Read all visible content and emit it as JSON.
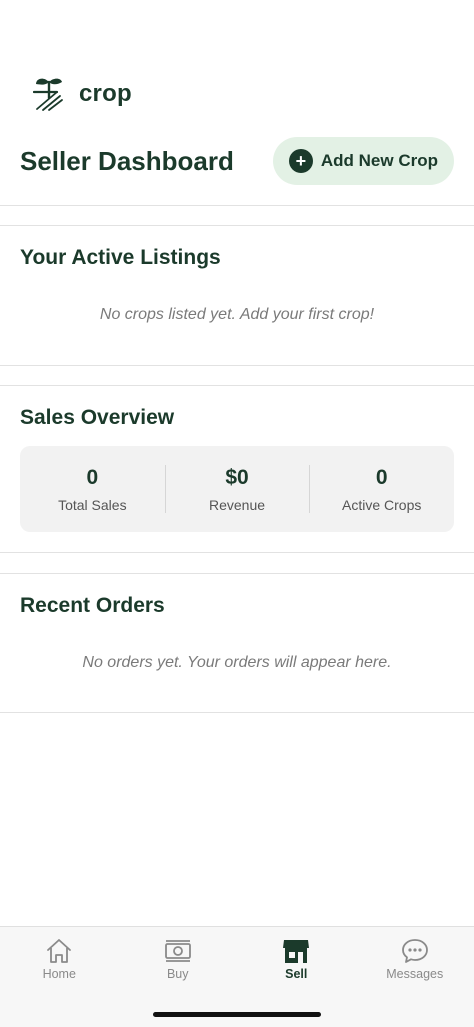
{
  "app": {
    "name": "crop"
  },
  "header": {
    "title": "Seller Dashboard",
    "add_button_label": "Add New Crop"
  },
  "listings": {
    "title": "Your Active Listings",
    "empty_text": "No crops listed yet. Add your first crop!"
  },
  "sales": {
    "title": "Sales Overview",
    "stats": [
      {
        "value": "0",
        "label": "Total Sales"
      },
      {
        "value": "$0",
        "label": "Revenue"
      },
      {
        "value": "0",
        "label": "Active Crops"
      }
    ]
  },
  "orders": {
    "title": "Recent Orders",
    "empty_text": "No orders yet. Your orders will appear here."
  },
  "tabbar": {
    "items": [
      {
        "label": "Home",
        "icon": "home-icon"
      },
      {
        "label": "Buy",
        "icon": "cash-icon"
      },
      {
        "label": "Sell",
        "icon": "storefront-icon",
        "active": true
      },
      {
        "label": "Messages",
        "icon": "chat-bubble-icon"
      }
    ]
  },
  "colors": {
    "primary": "#1b3a2b",
    "accent_bg": "#e3f1e5",
    "muted_text": "#7a7a7a"
  }
}
